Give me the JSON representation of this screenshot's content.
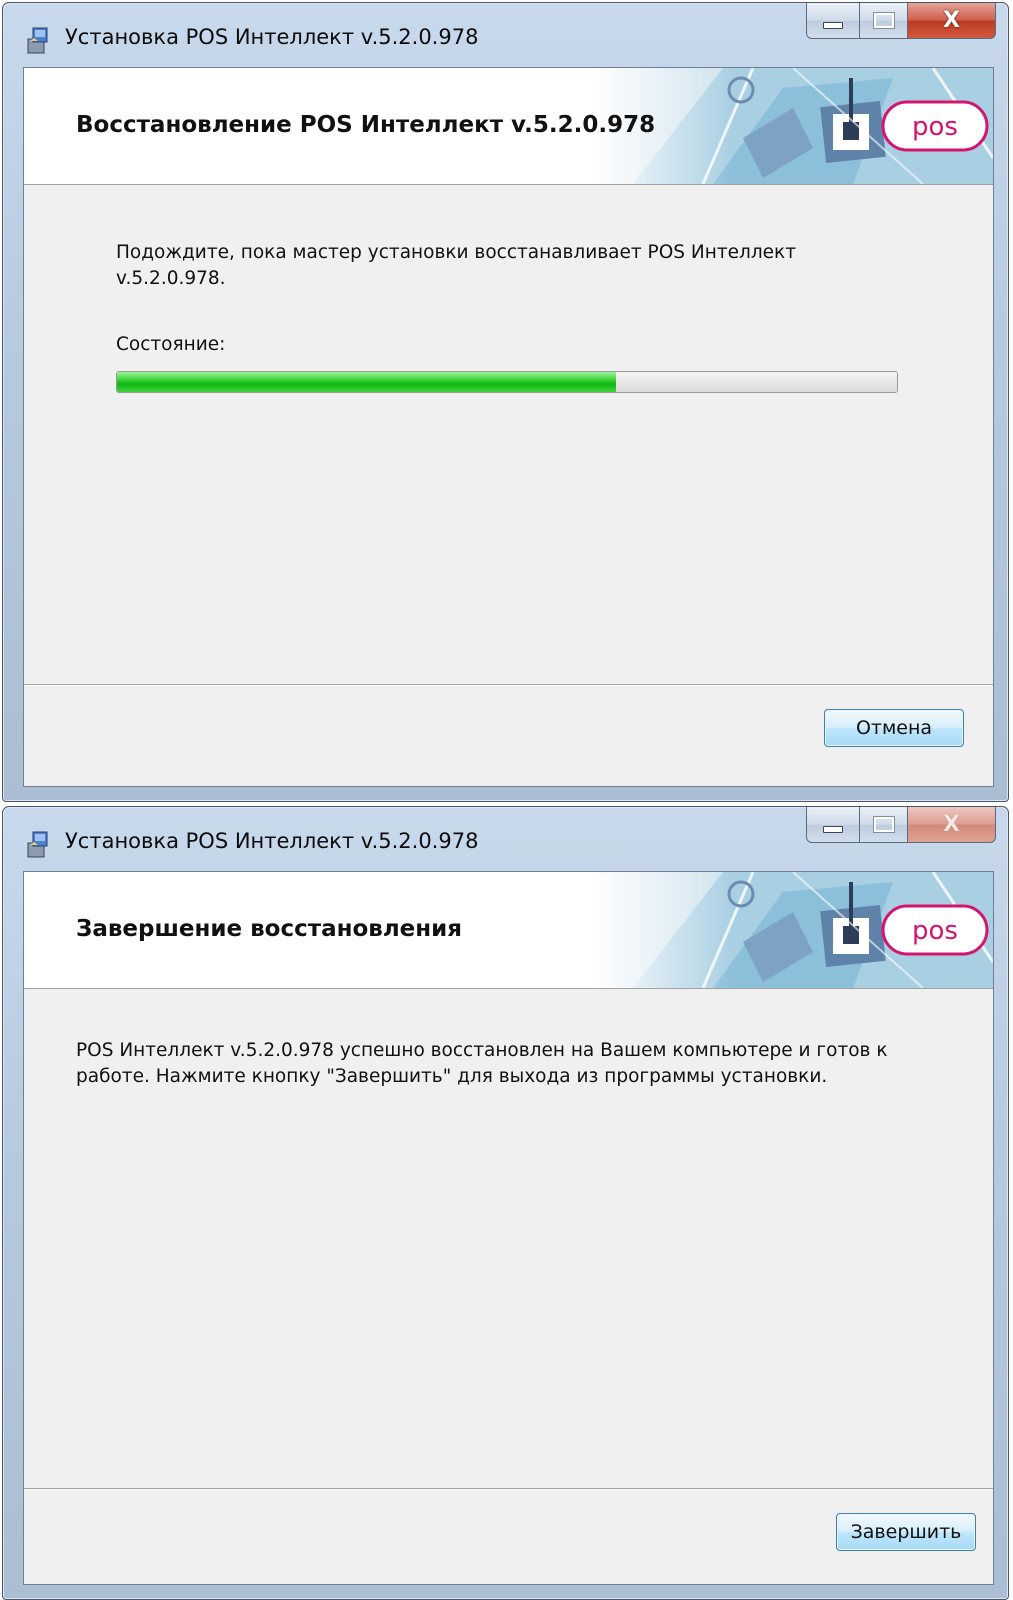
{
  "colors": {
    "frame": "#b5c9df",
    "client_bg": "#f0f0f0",
    "progress_green": "#0eb512",
    "button_border": "#3c7fb1",
    "logo_pink": "#d4146e"
  },
  "window_controls": {
    "minimize_icon": "minimize-icon",
    "maximize_icon": "maximize-icon",
    "close_glyph": "X"
  },
  "logo_text": "pos",
  "dialog1": {
    "title": "Установка POS Интеллект v.5.2.0.978",
    "heading": "Восстановление POS Интеллект v.5.2.0.978",
    "message_line1": "Подождите, пока мастер установки восстанавливает POS Интеллект",
    "message_line2": "v.5.2.0.978.",
    "status_label": "Состояние:",
    "progress_fraction": 0.64,
    "cancel_button": "Отмена"
  },
  "dialog2": {
    "title": "Установка POS Интеллект v.5.2.0.978",
    "heading": "Завершение восстановления",
    "message_line1": "POS Интеллект v.5.2.0.978 успешно восстановлен на Вашем компьютере и готов к",
    "message_line2": "работе. Нажмите кнопку \"Завершить\" для выхода из программы установки.",
    "finish_button": "Завершить"
  }
}
